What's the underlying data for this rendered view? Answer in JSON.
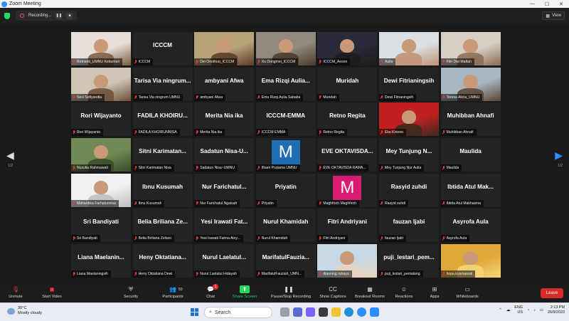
{
  "window": {
    "title": "Zoom Meeting",
    "controls": [
      "—",
      "☐",
      "✕"
    ]
  },
  "topbar": {
    "recording_label": "Recording...",
    "view_label": "View"
  },
  "navigation": {
    "left_page": "1/2",
    "right_page": "1/2",
    "left_icon": "chevron-left-icon",
    "right_icon": "chevron-right-icon"
  },
  "participants": [
    {
      "name": "",
      "label": "Retnanti_UMNU Kebumen",
      "type": "photo",
      "colors": [
        "#e8e0d8",
        "#7a5a3e"
      ]
    },
    {
      "name": "ICCCM",
      "label": "ICCCM",
      "type": "name"
    },
    {
      "name": "",
      "label": "Dei Onothuo_ICCCM",
      "type": "photo",
      "colors": [
        "#b8a27a",
        "#5a3b28"
      ]
    },
    {
      "name": "",
      "label": "Xu Dongmei_ICCCM",
      "type": "photo",
      "colors": [
        "#8f8a7d",
        "#4a3a2b"
      ]
    },
    {
      "name": "",
      "label": "ICCCM_Aeson",
      "type": "photo",
      "colors": [
        "#2a2a3a",
        "#1c1c1c"
      ]
    },
    {
      "name": "",
      "label": "Aulia",
      "type": "photo",
      "colors": [
        "#d9dfe2",
        "#c09070"
      ],
      "speaking": true
    },
    {
      "name": "",
      "label": "Fitri Dwi Maftah",
      "type": "photo",
      "colors": [
        "#d6cfc5",
        "#8a6c52"
      ]
    },
    {
      "name": "",
      "label": "Sevi Sofiyandia",
      "type": "photo",
      "colors": [
        "#cfc5b5",
        "#6b4f3a"
      ]
    },
    {
      "name": "Tarisa Via ningrum...",
      "label": "Tarisa Via ningrum UMNU",
      "type": "name"
    },
    {
      "name": "ambyani Afwa",
      "label": "ambyani Afwa",
      "type": "name"
    },
    {
      "name": "Ema Rizqi Aulia...",
      "label": "Ema Rizqi Aulia Sababa",
      "type": "name"
    },
    {
      "name": "Muridah",
      "label": "Muridah",
      "type": "name"
    },
    {
      "name": "Dewi Fitrianingsih",
      "label": "Dewi Fitrianingsih",
      "type": "name"
    },
    {
      "name": "",
      "label": "Teresa Alicia_UMNU",
      "type": "photo",
      "colors": [
        "#a8b6c2",
        "#5a4435"
      ]
    },
    {
      "name": "Rori Wijayanto",
      "label": "Rori Wijayanto",
      "type": "name"
    },
    {
      "name": "FADILA KHOIRU...",
      "label": "FADILA KHOIRUNNISA",
      "type": "name"
    },
    {
      "name": "Merita Nia ika",
      "label": "Merita Nia ika",
      "type": "name"
    },
    {
      "name": "ICCCM-EMMA",
      "label": "ICCCM-EMMA",
      "type": "name"
    },
    {
      "name": "Retno Regita",
      "label": "Retno Regita",
      "type": "name"
    },
    {
      "name": "",
      "label": "Eko Kiriono",
      "type": "photo",
      "colors": [
        "#c02020",
        "#3a2a20"
      ]
    },
    {
      "name": "Muhibban Ahnafi",
      "label": "Muhibban Ahnafi",
      "type": "name"
    },
    {
      "name": "",
      "label": "Nuzulia Rahmawati",
      "type": "photo",
      "colors": [
        "#6f8a55",
        "#3a4a2a"
      ]
    },
    {
      "name": "Sitni Karimatan...",
      "label": "Sitni Karimatan Nisa",
      "type": "name"
    },
    {
      "name": "Sadatun Nisa-U...",
      "label": "Sadatun Nisa~UMNU",
      "type": "name"
    },
    {
      "name": "",
      "label": "Ilham Pratama UMNU",
      "type": "avatar",
      "letter": "M",
      "color": "#1f6db3"
    },
    {
      "name": "EVE OKTAVISDA...",
      "label": "EVE OKTAVISDA RAMA...",
      "type": "name"
    },
    {
      "name": "Mey Tunjung N...",
      "label": "Mey Tunjung Nur Aulia",
      "type": "name"
    },
    {
      "name": "Maulida",
      "label": "Maulida",
      "type": "name"
    },
    {
      "name": "",
      "label": "Mahardika Farhatunnisa",
      "type": "photo",
      "colors": [
        "#f0f0f0",
        "#bdbdbd"
      ]
    },
    {
      "name": "Ibnu Kusumah",
      "label": "Ibnu Kusumah",
      "type": "name"
    },
    {
      "name": "Nur Farichatul...",
      "label": "Nur Farichatul Ngaisah",
      "type": "name"
    },
    {
      "name": "Priyatin",
      "label": "Priyatin",
      "type": "name"
    },
    {
      "name": "",
      "label": "Maghfiroh Maghfiroh",
      "type": "avatar",
      "letter": "M",
      "color": "#d81b72"
    },
    {
      "name": "Rasyid zuhdi",
      "label": "Rasyid zuhdi",
      "type": "name"
    },
    {
      "name": "Ibtida Atul Mak...",
      "label": "Ibtida Atul Makhasina",
      "type": "name"
    },
    {
      "name": "Sri Bandiyati",
      "label": "Sri Bandiyati",
      "type": "name"
    },
    {
      "name": "Belia Briliana Ze...",
      "label": "Belia Briliana Zeliani",
      "type": "name"
    },
    {
      "name": "Yesi Irawati Fat...",
      "label": "Yesi Irawati Fatma Ainy...",
      "type": "name"
    },
    {
      "name": "Nurul Khamidah",
      "label": "Nurul Khamidah",
      "type": "name"
    },
    {
      "name": "Fitri Andriyani",
      "label": "Fitri Andriyani",
      "type": "name"
    },
    {
      "name": "fauzan ljabi",
      "label": "fauzan ljabi",
      "type": "name"
    },
    {
      "name": "Asyrofa Aula",
      "label": "Asyrofa Aula",
      "type": "name"
    },
    {
      "name": "Liana Maelanin...",
      "label": "Liana Maelaningsih",
      "type": "name"
    },
    {
      "name": "Heny Oktatiana...",
      "label": "Heny Oktatiana Dewi",
      "type": "name"
    },
    {
      "name": "Nurul Laelatul...",
      "label": "Nurul Laelatul Hidayah",
      "type": "name"
    },
    {
      "name": "MarifatulFauzia...",
      "label": "MarifatulFauziah_UMN...",
      "type": "name"
    },
    {
      "name": "",
      "label": "dianning rahayu",
      "type": "photo",
      "colors": [
        "#c7d9e6",
        "#e8d4bd"
      ]
    },
    {
      "name": "puji_lestari_pem...",
      "label": "puji_lestari_pemalang",
      "type": "name"
    },
    {
      "name": "",
      "label": "hopa.kusmawati",
      "type": "photo",
      "colors": [
        "#e0a838",
        "#f5d77a"
      ]
    }
  ],
  "toolbar": {
    "items": [
      {
        "key": "unmute",
        "label": "Unmute",
        "icon": "mic-muted-icon"
      },
      {
        "key": "video",
        "label": "Start Video",
        "icon": "video-off-icon"
      },
      {
        "key": "security",
        "label": "Security",
        "icon": "shield-icon"
      },
      {
        "key": "participants",
        "label": "Participants",
        "icon": "participants-icon",
        "count": "50"
      },
      {
        "key": "chat",
        "label": "Chat",
        "icon": "chat-icon",
        "badge": "1"
      },
      {
        "key": "share",
        "label": "Share Screen",
        "icon": "share-screen-icon"
      },
      {
        "key": "record",
        "label": "Pause/Stop Recording",
        "icon": "record-icon"
      },
      {
        "key": "captions",
        "label": "Show Captions",
        "icon": "captions-icon"
      },
      {
        "key": "breakout",
        "label": "Breakout Rooms",
        "icon": "breakout-icon"
      },
      {
        "key": "reactions",
        "label": "Reactions",
        "icon": "reactions-icon"
      },
      {
        "key": "apps",
        "label": "Apps",
        "icon": "apps-icon"
      },
      {
        "key": "whiteboards",
        "label": "Whiteboards",
        "icon": "whiteboard-icon"
      }
    ],
    "leave_label": "Leave"
  },
  "taskbar": {
    "weather": {
      "temp": "30°C",
      "desc": "Mostly cloudy"
    },
    "search_placeholder": "Search",
    "lang": "ENG",
    "region": "US",
    "time": "2:13 PM",
    "date": "26/9/2023",
    "colors": {
      "accent": "#2d8cff",
      "mute": "#e53935",
      "speaking": "#23d959"
    }
  }
}
